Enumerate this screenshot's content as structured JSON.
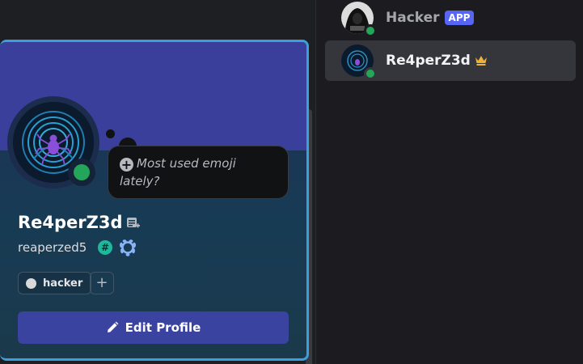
{
  "member_list": [
    {
      "name": "Hacker",
      "badge": "APP",
      "status": "online",
      "icon": "hooded-hacker-avatar"
    },
    {
      "name": "Re4perZ3d",
      "owner_icon": "crown-icon",
      "status": "online",
      "selected": true,
      "icon": "spider-fingerprint-avatar"
    }
  ],
  "profile": {
    "display_name": "Re4perZ3d",
    "username": "reaperzed5",
    "status_prompt": "Most used emoji lately?",
    "hash_badge": "#",
    "roles": [
      {
        "label": "hacker",
        "color": "#d9d9d9"
      }
    ],
    "add_role_label": "+",
    "edit_button_label": "Edit Profile"
  },
  "colors": {
    "online": "#23a55a",
    "app_badge": "#5865f2",
    "banner": "#3a3f9c",
    "card_border": "#3b9fde",
    "edit_button": "#3a43a0"
  }
}
